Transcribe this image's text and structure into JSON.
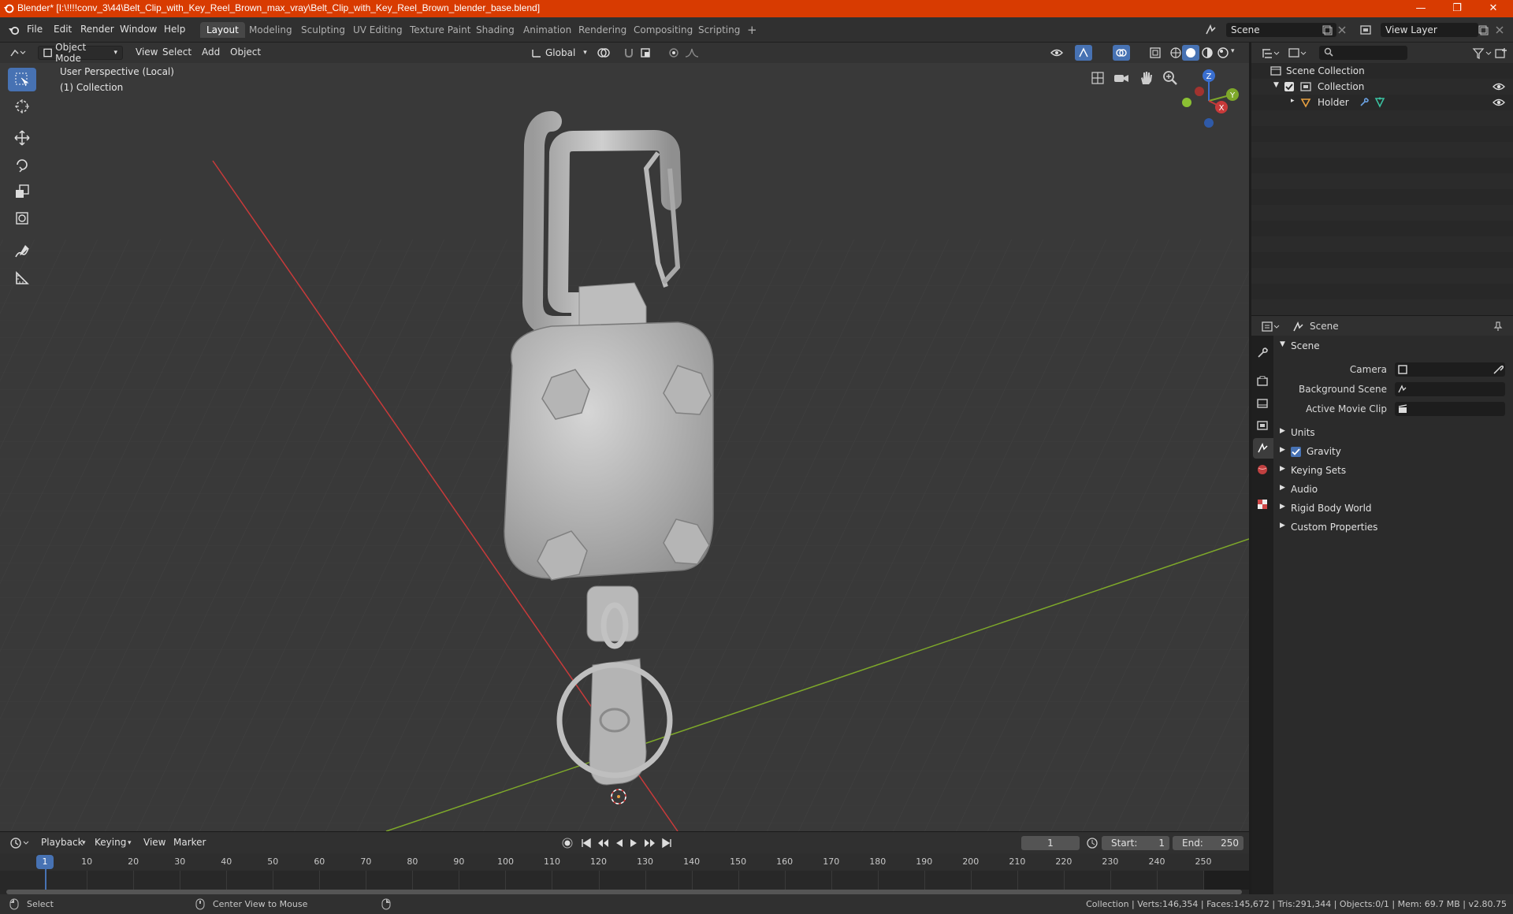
{
  "window": {
    "title": "Blender* [I:\\!!!!conv_3\\44\\Belt_Clip_with_Key_Reel_Brown_max_vray\\Belt_Clip_with_Key_Reel_Brown_blender_base.blend]",
    "minimize": "—",
    "maximize": "❐",
    "close": "✕"
  },
  "menu": [
    "File",
    "Edit",
    "Render",
    "Window",
    "Help"
  ],
  "workspaces": [
    "Layout",
    "Modeling",
    "Sculpting",
    "UV Editing",
    "Texture Paint",
    "Shading",
    "Animation",
    "Rendering",
    "Compositing",
    "Scripting"
  ],
  "active_workspace": "Layout",
  "add_workspace": "+",
  "scene_field": "Scene",
  "view_layer_field": "View Layer",
  "viewport": {
    "mode": "Object Mode",
    "menus": [
      "View",
      "Select",
      "Add",
      "Object"
    ],
    "transform_orientation": "Global",
    "perspective_label": "User Perspective (Local)",
    "collection_label": "(1) Collection",
    "gizmo": {
      "x": "X",
      "y": "Y",
      "z": "Z"
    }
  },
  "outliner": {
    "search_placeholder": "",
    "items": [
      {
        "label": "Scene Collection"
      },
      {
        "label": "Collection"
      },
      {
        "label": "Holder"
      }
    ]
  },
  "properties": {
    "header_title": "Scene",
    "panel_title": "Scene",
    "fields": [
      {
        "label": "Camera"
      },
      {
        "label": "Background Scene"
      },
      {
        "label": "Active Movie Clip"
      }
    ],
    "panels": [
      "Units",
      "Gravity",
      "Keying Sets",
      "Audio",
      "Rigid Body World",
      "Custom Properties"
    ],
    "gravity_checked": true
  },
  "timeline": {
    "menus": [
      "Playback",
      "Keying",
      "View",
      "Marker"
    ],
    "current_frame": "1",
    "start_label": "Start:",
    "start": "1",
    "end_label": "End:",
    "end": "250",
    "ticks": [
      "1",
      "10",
      "20",
      "30",
      "40",
      "50",
      "60",
      "70",
      "80",
      "90",
      "100",
      "110",
      "120",
      "130",
      "140",
      "150",
      "160",
      "170",
      "180",
      "190",
      "200",
      "210",
      "220",
      "230",
      "240",
      "250"
    ]
  },
  "status": {
    "select": "Select",
    "center_view": "Center View to Mouse",
    "stats": "Collection | Verts:146,354 | Faces:145,672 | Tris:291,344 | Objects:0/1 | Mem: 69.7 MB | v2.80.75"
  },
  "colors": {
    "titlebar": "#d83b01",
    "accent": "#4772b3",
    "x_axis": "#c83a3a",
    "y_axis": "#7ea82a",
    "object": "#c4c4c4"
  }
}
